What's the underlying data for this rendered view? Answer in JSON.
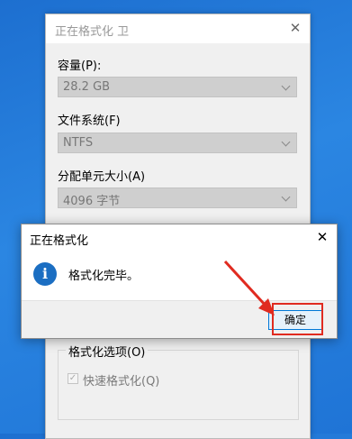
{
  "format_dialog": {
    "title": "正在格式化 卫",
    "capacity": {
      "label": "容量(P):",
      "value": "28.2 GB"
    },
    "filesystem": {
      "label": "文件系统(F)",
      "value": "NTFS"
    },
    "allocation": {
      "label": "分配单元大小(A)",
      "value": "4096 字节"
    },
    "options": {
      "title": "格式化选项(O)",
      "quick_format": "快速格式化(Q)"
    }
  },
  "message_box": {
    "title": "正在格式化",
    "text": "格式化完毕。",
    "ok_label": "确定"
  },
  "icons": {
    "close": "✕",
    "check": "✓",
    "info": "i"
  },
  "colors": {
    "highlight": "#e02b20",
    "accent": "#0078d7",
    "info_icon": "#1b6ec2"
  }
}
